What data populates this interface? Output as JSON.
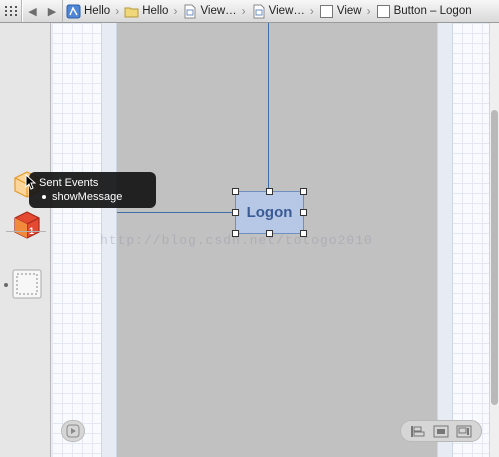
{
  "jumpbar": {
    "grid_icon": "related-items-icon",
    "back_icon": "chevron-left-icon",
    "forward_icon": "chevron-right-icon",
    "crumbs": [
      {
        "label": "Hello",
        "icon": "xcode-project-icon"
      },
      {
        "label": "Hello",
        "icon": "folder-icon"
      },
      {
        "label": "View…",
        "icon": "storyboard-file-icon"
      },
      {
        "label": "View…",
        "icon": "storyboard-file-icon"
      },
      {
        "label": "View",
        "icon": "view-icon"
      },
      {
        "label": "Button – Logon",
        "icon": "button-icon"
      }
    ]
  },
  "library": {
    "items": [
      {
        "name": "object-cube-icon",
        "color": "#f4a43c"
      },
      {
        "name": "first-responder-cube-icon",
        "color": "#e0432e"
      },
      {
        "name": "view-placeholder-icon",
        "color": "#ffffff"
      }
    ]
  },
  "canvas": {
    "button_label": "Logon",
    "watermark": "http://blog.csdn.net/totogo2010",
    "accent": "#3e6da8"
  },
  "tooltip": {
    "title": "Sent Events",
    "item": "showMessage"
  },
  "controls": {
    "play_icon": "play-circle-icon",
    "layout_icons": [
      "align-icon",
      "pin-icon",
      "resize-icon"
    ]
  }
}
